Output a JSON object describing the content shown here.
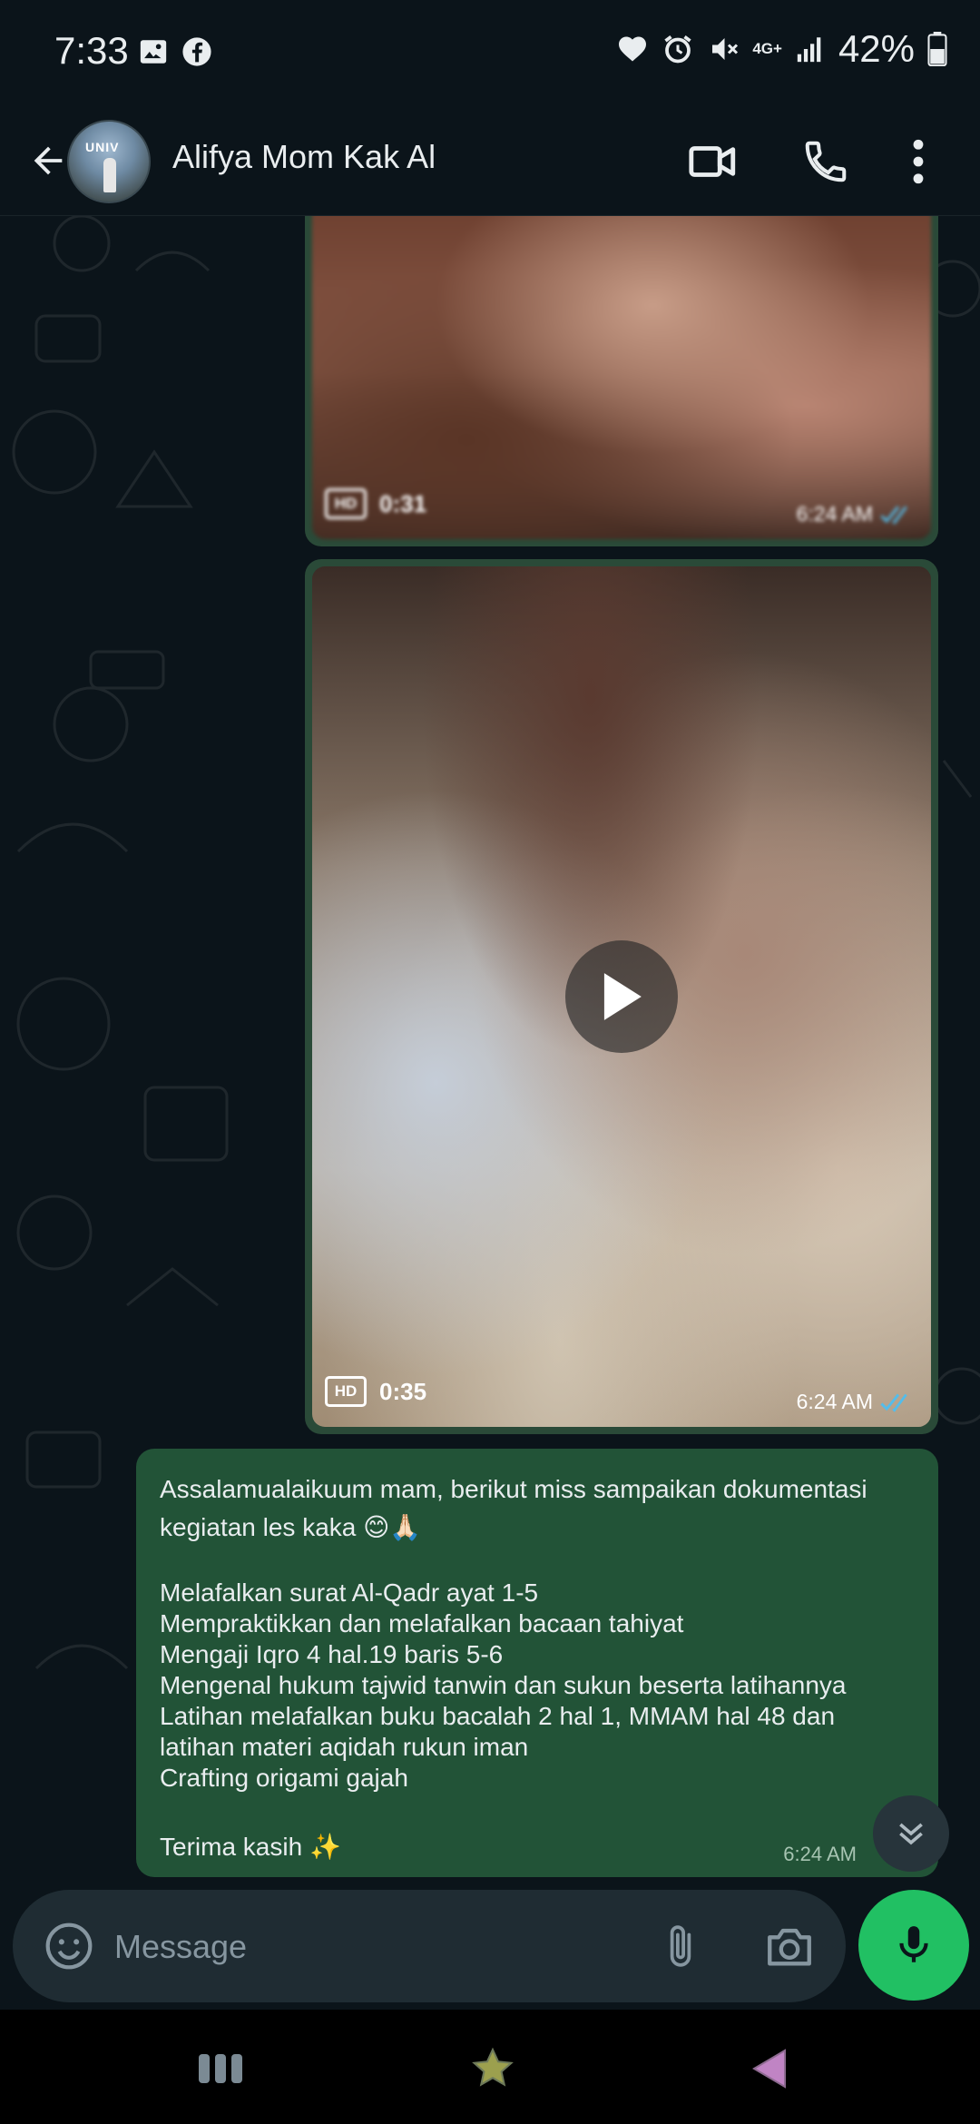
{
  "status_bar": {
    "time": "7:33",
    "network": "4G+",
    "battery": "42%"
  },
  "header": {
    "contact_name": "Alifya Mom Kak Al",
    "avatar_text": "UNIV"
  },
  "messages": {
    "video1": {
      "hd": "HD",
      "duration": "0:31",
      "time": "6:24 AM"
    },
    "video2": {
      "hd": "HD",
      "duration": "0:35",
      "time": "6:24 AM"
    },
    "text": {
      "line1": "Assalamualaikuum mam, berikut miss sampaikan dokumentasi",
      "line2": "kegiatan les kaka 😊🙏🏻",
      "item1": "Melafalkan surat Al-Qadr ayat 1-5",
      "item2": "Mempraktikkan dan melafalkan bacaan tahiyat",
      "item3": "Mengaji Iqro 4 hal.19 baris 5-6",
      "item4": "Mengenal hukum tajwid tanwin dan sukun beserta latihannya",
      "item5a": "Latihan melafalkan buku bacalah 2 hal 1, MMAM hal 48 dan",
      "item5b": "latihan materi aqidah rukun iman",
      "item6": "Crafting origami gajah",
      "closing": "Terima kasih ✨",
      "time": "6:24 AM"
    }
  },
  "input": {
    "placeholder": "Message"
  },
  "colors": {
    "bubble_out": "#225337",
    "mic_green": "#21c063",
    "read_tick": "#53bdeb"
  }
}
